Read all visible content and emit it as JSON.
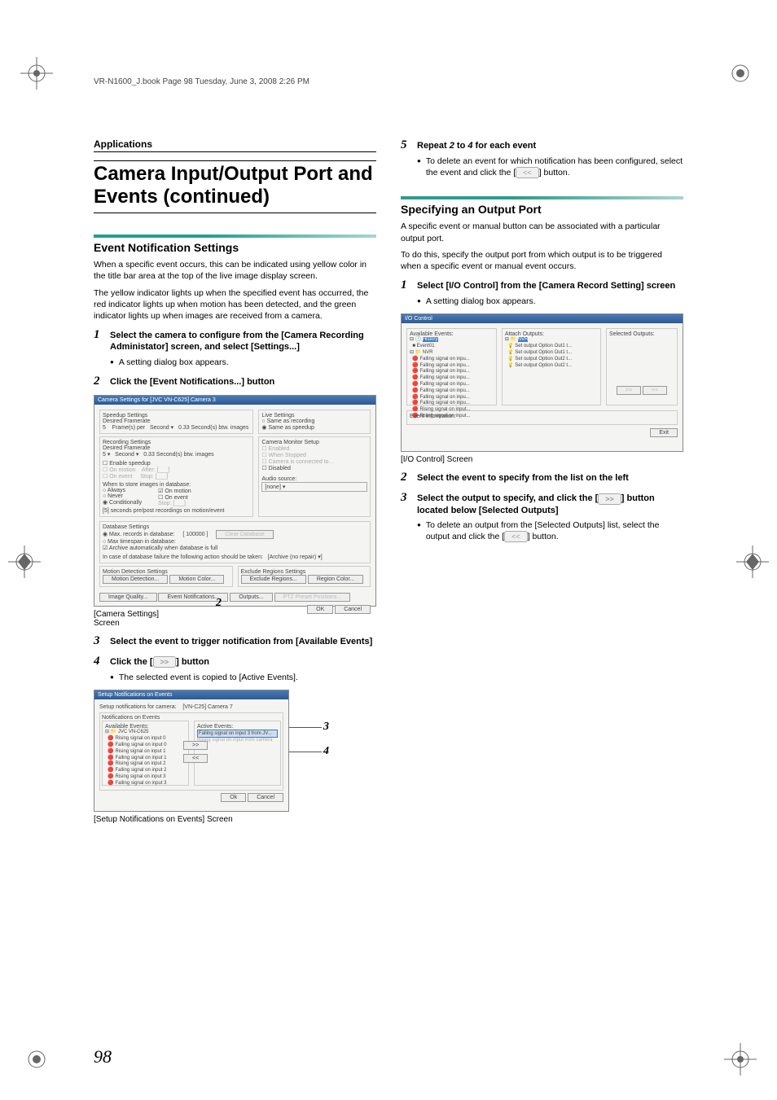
{
  "header_meta": "VR-N1600_J.book  Page 98  Tuesday, June 3, 2008  2:26 PM",
  "section_label": "Applications",
  "main_title": "Camera Input/Output Port and Events (continued)",
  "left": {
    "h2": "Event Notification Settings",
    "p1": "When a specific event occurs, this can be indicated using yellow color in the title bar area at the top of the live image display screen.",
    "p2": "The yellow indicator lights up when the specified event has occurred, the red indicator lights up when motion has been detected, and the green indicator lights up when images are received from a camera.",
    "step1": "Select the camera to configure from the [Camera Recording Administator] screen, and select [Settings...]",
    "step1_bullet": "A setting dialog box appears.",
    "step2": "Click the [Event Notifications...] button",
    "caption1a": "[Camera Settings]",
    "caption1b": "Screen",
    "step3": "Select the event to trigger notification from [Available Events]",
    "step4_pre": "Click the [",
    "step4_post": "] button",
    "step4_bullet": "The selected event is copied to [Active Events].",
    "caption2": "[Setup Notifications on Events] Screen",
    "ss1_title": "Camera Settings for [JVC VN-C625] Camera 3",
    "ss2_title": "Setup Notifications on Events"
  },
  "right": {
    "step5_pre": "Repeat ",
    "step5_mid1": "2",
    "step5_mid2": " to ",
    "step5_mid3": "4",
    "step5_post": " for each event",
    "step5_bullet_pre": "To delete an event for which notification has been configured, select the event and click the [",
    "step5_bullet_post": "] button.",
    "h2": "Specifying an Output Port",
    "p1": "A specific event or manual button can be associated with a particular output port.",
    "p2": "To do this, specify the output port from which output is to be triggered when a specific event or manual event occurs.",
    "step1": "Select [I/O Control] from the [Camera Record Setting] screen",
    "step1_bullet": "A setting dialog box appears.",
    "caption1": "[I/O Control] Screen",
    "step2": "Select the event to specify from the list on the left",
    "step3_pre": "Select the output to specify, and click the [",
    "step3_post": "] button located below [Selected Outputs]",
    "step3_bullet_pre": "To delete an output from the [Selected Outputs] list, select the output and click the [",
    "step3_bullet_post": "] button.",
    "ss_title": "I/O Control"
  },
  "page_number": "98",
  "callouts": {
    "c2": "2",
    "c3": "3",
    "c4": "4"
  },
  "btn_glyph_right": ">>",
  "btn_glyph_left": "<<"
}
